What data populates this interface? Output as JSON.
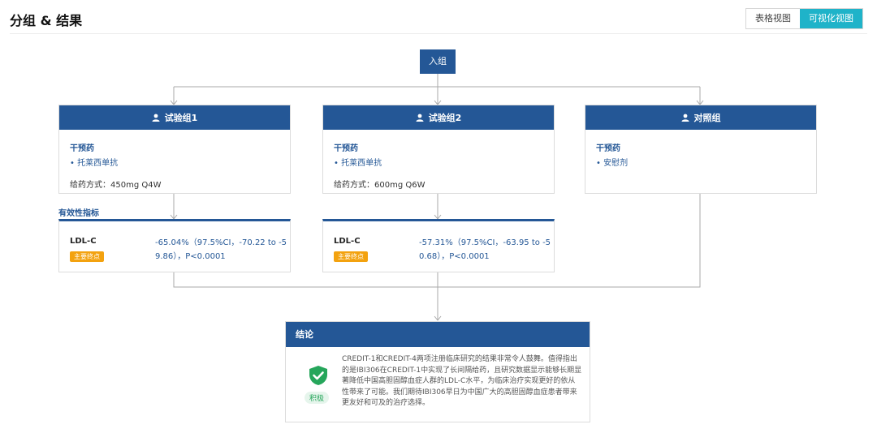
{
  "header": {
    "title": "分组 & 结果",
    "view_tabs": [
      {
        "label": "表格视图",
        "active": false
      },
      {
        "label": "可视化视图",
        "active": true
      }
    ]
  },
  "flow": {
    "entry_label": "入组",
    "groups": [
      {
        "name": "试验组1",
        "intervention_label": "干预药",
        "drug": "• 托莱西单抗",
        "dosing": "给药方式：450mg Q4W"
      },
      {
        "name": "试验组2",
        "intervention_label": "干预药",
        "drug": "• 托莱西单抗",
        "dosing": "给药方式：600mg Q6W"
      },
      {
        "name": "对照组",
        "intervention_label": "干预药",
        "drug": "• 安慰剂",
        "dosing": ""
      }
    ],
    "efficacy_title": "有效性指标",
    "efficacy": [
      {
        "indicator": "LDL-C",
        "badge": "主要终点",
        "value": "-65.04%（97.5%CI，-70.22 to -59.86），P<0.0001"
      },
      {
        "indicator": "LDL-C",
        "badge": "主要终点",
        "value": "-57.31%（97.5%CI，-63.95 to -50.68），P<0.0001"
      }
    ],
    "conclusion": {
      "title": "结论",
      "badge": "积极",
      "text": "CREDIT-1和CREDIT-4两项注册临床研究的结果非常令人鼓舞。值得指出的是IBI306在CREDIT-1中实现了长间隔给药，且研究数据显示能够长期显著降低中国高胆固醇血症人群的LDL-C水平，为临床治疗实现更好的依从性带来了可能。我们期待IBI306早日为中国广大的高胆固醇血症患者带来更友好和可及的治疗选择。"
    }
  },
  "colors": {
    "primary": "#245796",
    "accent": "#1fb3c9",
    "badge": "#f3a20f",
    "positive": "#26a65b"
  }
}
